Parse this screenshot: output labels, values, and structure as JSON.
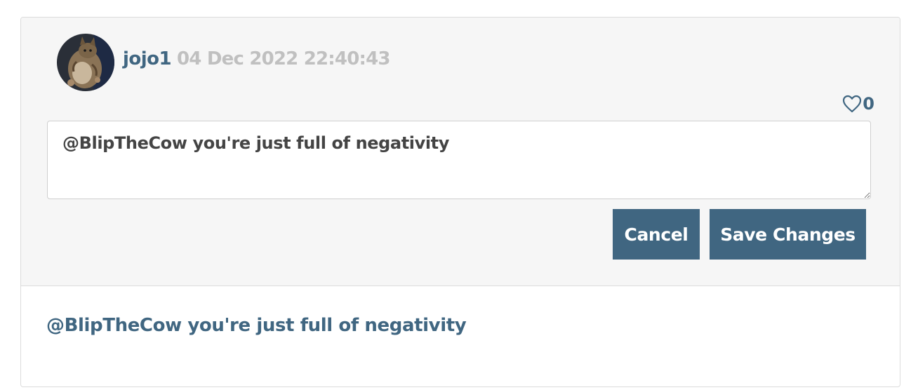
{
  "comment": {
    "author": "jojo1",
    "timestamp": "04 Dec 2022 22:40:43",
    "avatar_icon": "cat-photo-avatar",
    "like_icon": "heart-outline-icon",
    "like_count": "0",
    "text": "@BlipTheCow you're just full of negativity"
  },
  "editor": {
    "value": "@BlipTheCow you're just full of negativity",
    "cancel_label": "Cancel",
    "save_label": "Save Changes"
  },
  "colors": {
    "accent": "#406681",
    "timestamp": "#c0c0c0",
    "edit_background": "#f6f6f6",
    "card_border": "#dcdcdc"
  }
}
